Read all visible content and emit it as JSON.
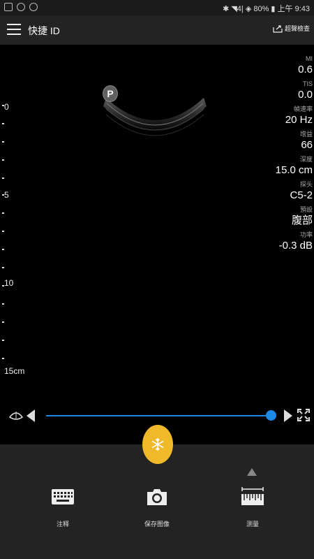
{
  "status_bar": {
    "right_text": "✱ ◥4| ◈ 80% ▮ 上午 9:43"
  },
  "app_bar": {
    "title": "快捷 ID",
    "export_label": "超聲檢查"
  },
  "image": {
    "probe_marker": "P",
    "depth_labels": [
      "0",
      "5",
      "10",
      "15cm"
    ]
  },
  "parameters": [
    {
      "label": "MI",
      "value": "0.6"
    },
    {
      "label": "TIS",
      "value": "0.0"
    },
    {
      "label": "幀速率",
      "value": "20 Hz"
    },
    {
      "label": "增益",
      "value": "66"
    },
    {
      "label": "深度",
      "value": "15.0 cm"
    },
    {
      "label": "探头",
      "value": "C5-2"
    },
    {
      "label": "預設",
      "value": "腹部"
    },
    {
      "label": "功率",
      "value": "-0.3 dB"
    }
  ],
  "slider": {
    "value_fraction": 0.99
  },
  "toolbar": {
    "keyboard_label": "注释",
    "capture_label": "保存图像",
    "measure_label": "测量"
  },
  "colors": {
    "accent_blue": "#1e88e5",
    "freeze_yellow": "#f0b92a"
  },
  "icons": [
    "hamburger-icon",
    "export-icon",
    "sector-icon",
    "snowflake-icon",
    "keyboard-icon",
    "camera-icon",
    "ruler-icon",
    "fullscreen-icon"
  ]
}
